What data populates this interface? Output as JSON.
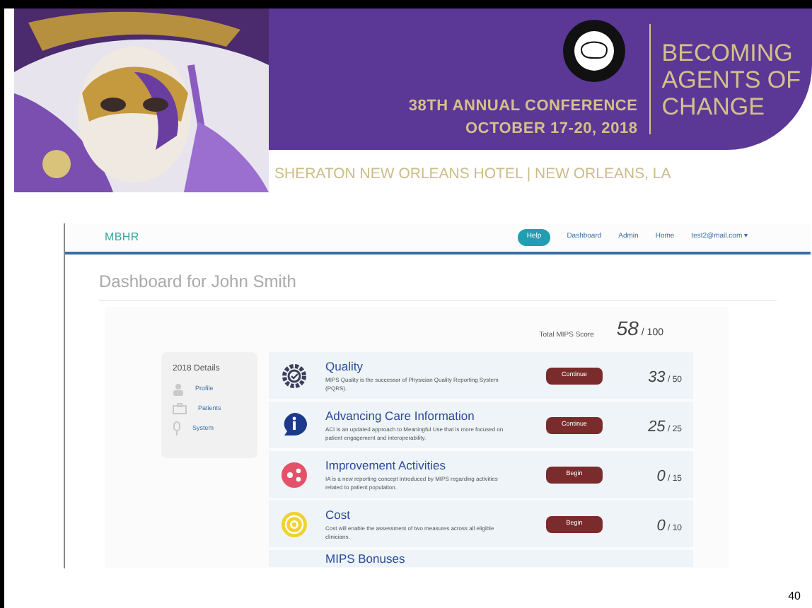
{
  "banner": {
    "line_1": "38TH ANNUAL CONFERENCE",
    "line_2": "OCTOBER 17-20, 2018",
    "theme": [
      "BECOMING",
      "AGENTS OF",
      "CHANGE"
    ],
    "venue": "SHERATON NEW ORLEANS HOTEL | NEW ORLEANS, LA"
  },
  "app": {
    "logo": "MBHR",
    "nav": [
      {
        "label": "Help",
        "kind": "pill"
      },
      {
        "label": "Dashboard",
        "kind": "link"
      },
      {
        "label": "Admin",
        "kind": "link"
      },
      {
        "label": "Home",
        "kind": "link"
      },
      {
        "label": "test2@mail.com ▾",
        "kind": "link"
      }
    ],
    "title": "Dashboard for John Smith",
    "total": {
      "label": "Total MIPS Score",
      "score": "58",
      "max": "/ 100"
    },
    "sidebar": {
      "title": "2018 Details",
      "items": [
        {
          "label": "Profile"
        },
        {
          "label": "Patients"
        },
        {
          "label": "System"
        }
      ]
    },
    "categories": [
      {
        "title": "Quality",
        "description": "MIPS Quality is the successor of Physician Quality Reporting System (PQRS).",
        "action": "Continue",
        "score": "33",
        "max": "/ 50"
      },
      {
        "title": "Advancing Care Information",
        "description": "ACI is an updated approach to Meaningful Use that is more focused on patient engagement and interoperability.",
        "action": "Continue",
        "score": "25",
        "max": "/ 25"
      },
      {
        "title": "Improvement Activities",
        "description": "IA is a new reporting concept introduced by MIPS regarding activities related to patient population.",
        "action": "Begin",
        "score": "0",
        "max": "/ 15"
      },
      {
        "title": "Cost",
        "description": "Cost will enable the assessment of two measures across all eligible clinicians.",
        "action": "Begin",
        "score": "0",
        "max": "/ 10"
      },
      {
        "title": "MIPS Bonuses"
      }
    ]
  },
  "page_number": "40"
}
